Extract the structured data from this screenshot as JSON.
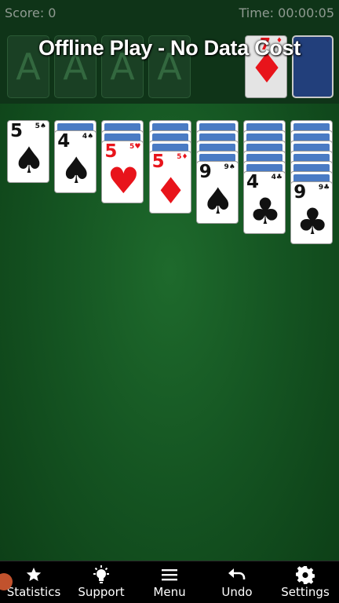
{
  "status": {
    "score": "Score: 0",
    "time": "Time: 00:00:05"
  },
  "banner": "Offline Play - No Data Cost",
  "foundations": [
    "A",
    "A",
    "A",
    "A"
  ],
  "waste_card": {
    "rank": "7",
    "suit": "♦",
    "color": "red"
  },
  "tableau": [
    {
      "hidden": 0,
      "rank": "5",
      "suit": "♠",
      "color": "black"
    },
    {
      "hidden": 1,
      "rank": "4",
      "suit": "♠",
      "color": "black"
    },
    {
      "hidden": 2,
      "rank": "5",
      "suit": "♥",
      "color": "red"
    },
    {
      "hidden": 3,
      "rank": "5",
      "suit": "♦",
      "color": "red"
    },
    {
      "hidden": 4,
      "rank": "9",
      "suit": "♠",
      "color": "black"
    },
    {
      "hidden": 5,
      "rank": "4",
      "suit": "♣",
      "color": "black"
    },
    {
      "hidden": 6,
      "rank": "9",
      "suit": "♣",
      "color": "black"
    }
  ],
  "nav": [
    {
      "label": "Statistics",
      "icon": "star-icon"
    },
    {
      "label": "Support",
      "icon": "lightbulb-icon"
    },
    {
      "label": "Menu",
      "icon": "menu-icon"
    },
    {
      "label": "Undo",
      "icon": "undo-icon"
    },
    {
      "label": "Settings",
      "icon": "gear-icon"
    }
  ],
  "colors": {
    "felt": "#155522",
    "card_back": "#4a7bc4",
    "red_suit": "#e8141b"
  }
}
